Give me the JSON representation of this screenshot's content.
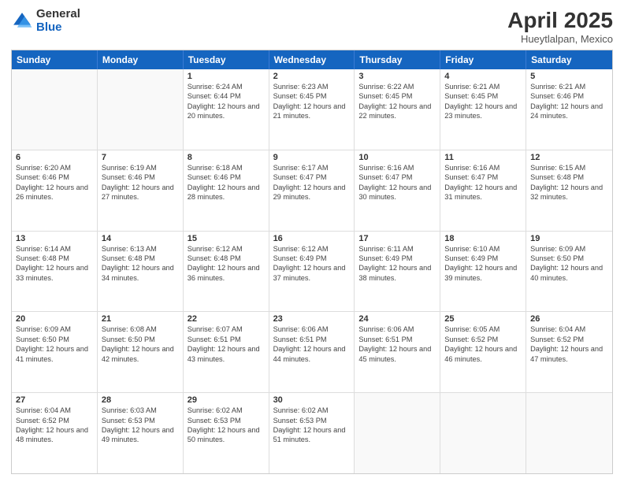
{
  "logo": {
    "general": "General",
    "blue": "Blue"
  },
  "header": {
    "title": "April 2025",
    "location": "Hueytlalpan, Mexico"
  },
  "days_of_week": [
    "Sunday",
    "Monday",
    "Tuesday",
    "Wednesday",
    "Thursday",
    "Friday",
    "Saturday"
  ],
  "weeks": [
    [
      {
        "day": "",
        "empty": true
      },
      {
        "day": "",
        "empty": true
      },
      {
        "day": "1",
        "sunrise": "6:24 AM",
        "sunset": "6:44 PM",
        "daylight": "12 hours and 20 minutes."
      },
      {
        "day": "2",
        "sunrise": "6:23 AM",
        "sunset": "6:45 PM",
        "daylight": "12 hours and 21 minutes."
      },
      {
        "day": "3",
        "sunrise": "6:22 AM",
        "sunset": "6:45 PM",
        "daylight": "12 hours and 22 minutes."
      },
      {
        "day": "4",
        "sunrise": "6:21 AM",
        "sunset": "6:45 PM",
        "daylight": "12 hours and 23 minutes."
      },
      {
        "day": "5",
        "sunrise": "6:21 AM",
        "sunset": "6:46 PM",
        "daylight": "12 hours and 24 minutes."
      }
    ],
    [
      {
        "day": "6",
        "sunrise": "6:20 AM",
        "sunset": "6:46 PM",
        "daylight": "12 hours and 26 minutes."
      },
      {
        "day": "7",
        "sunrise": "6:19 AM",
        "sunset": "6:46 PM",
        "daylight": "12 hours and 27 minutes."
      },
      {
        "day": "8",
        "sunrise": "6:18 AM",
        "sunset": "6:46 PM",
        "daylight": "12 hours and 28 minutes."
      },
      {
        "day": "9",
        "sunrise": "6:17 AM",
        "sunset": "6:47 PM",
        "daylight": "12 hours and 29 minutes."
      },
      {
        "day": "10",
        "sunrise": "6:16 AM",
        "sunset": "6:47 PM",
        "daylight": "12 hours and 30 minutes."
      },
      {
        "day": "11",
        "sunrise": "6:16 AM",
        "sunset": "6:47 PM",
        "daylight": "12 hours and 31 minutes."
      },
      {
        "day": "12",
        "sunrise": "6:15 AM",
        "sunset": "6:48 PM",
        "daylight": "12 hours and 32 minutes."
      }
    ],
    [
      {
        "day": "13",
        "sunrise": "6:14 AM",
        "sunset": "6:48 PM",
        "daylight": "12 hours and 33 minutes."
      },
      {
        "day": "14",
        "sunrise": "6:13 AM",
        "sunset": "6:48 PM",
        "daylight": "12 hours and 34 minutes."
      },
      {
        "day": "15",
        "sunrise": "6:12 AM",
        "sunset": "6:48 PM",
        "daylight": "12 hours and 36 minutes."
      },
      {
        "day": "16",
        "sunrise": "6:12 AM",
        "sunset": "6:49 PM",
        "daylight": "12 hours and 37 minutes."
      },
      {
        "day": "17",
        "sunrise": "6:11 AM",
        "sunset": "6:49 PM",
        "daylight": "12 hours and 38 minutes."
      },
      {
        "day": "18",
        "sunrise": "6:10 AM",
        "sunset": "6:49 PM",
        "daylight": "12 hours and 39 minutes."
      },
      {
        "day": "19",
        "sunrise": "6:09 AM",
        "sunset": "6:50 PM",
        "daylight": "12 hours and 40 minutes."
      }
    ],
    [
      {
        "day": "20",
        "sunrise": "6:09 AM",
        "sunset": "6:50 PM",
        "daylight": "12 hours and 41 minutes."
      },
      {
        "day": "21",
        "sunrise": "6:08 AM",
        "sunset": "6:50 PM",
        "daylight": "12 hours and 42 minutes."
      },
      {
        "day": "22",
        "sunrise": "6:07 AM",
        "sunset": "6:51 PM",
        "daylight": "12 hours and 43 minutes."
      },
      {
        "day": "23",
        "sunrise": "6:06 AM",
        "sunset": "6:51 PM",
        "daylight": "12 hours and 44 minutes."
      },
      {
        "day": "24",
        "sunrise": "6:06 AM",
        "sunset": "6:51 PM",
        "daylight": "12 hours and 45 minutes."
      },
      {
        "day": "25",
        "sunrise": "6:05 AM",
        "sunset": "6:52 PM",
        "daylight": "12 hours and 46 minutes."
      },
      {
        "day": "26",
        "sunrise": "6:04 AM",
        "sunset": "6:52 PM",
        "daylight": "12 hours and 47 minutes."
      }
    ],
    [
      {
        "day": "27",
        "sunrise": "6:04 AM",
        "sunset": "6:52 PM",
        "daylight": "12 hours and 48 minutes."
      },
      {
        "day": "28",
        "sunrise": "6:03 AM",
        "sunset": "6:53 PM",
        "daylight": "12 hours and 49 minutes."
      },
      {
        "day": "29",
        "sunrise": "6:02 AM",
        "sunset": "6:53 PM",
        "daylight": "12 hours and 50 minutes."
      },
      {
        "day": "30",
        "sunrise": "6:02 AM",
        "sunset": "6:53 PM",
        "daylight": "12 hours and 51 minutes."
      },
      {
        "day": "",
        "empty": true
      },
      {
        "day": "",
        "empty": true
      },
      {
        "day": "",
        "empty": true
      }
    ]
  ]
}
